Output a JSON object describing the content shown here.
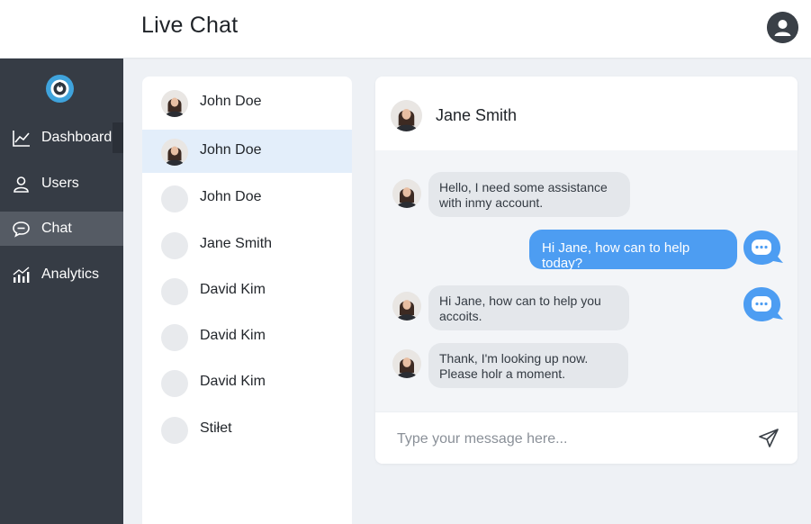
{
  "header": {
    "title": "Live Chat",
    "account_icon": "user-account-icon"
  },
  "sidebar": {
    "logo_icon": "app-logo",
    "items": [
      {
        "label": "Dashboard",
        "icon": "line-chart-icon",
        "active": false
      },
      {
        "label": "Users",
        "icon": "user-icon",
        "active": false
      },
      {
        "label": "Chat",
        "icon": "chat-bubble-icon",
        "active": true
      },
      {
        "label": "Analytics",
        "icon": "bar-chart-icon",
        "active": false
      }
    ]
  },
  "contacts": [
    {
      "name": "John Doe",
      "has_photo": true,
      "active": false
    },
    {
      "name": "John Doe",
      "has_photo": true,
      "active": true
    },
    {
      "name": "John Doe",
      "has_photo": false,
      "active": false
    },
    {
      "name": "Jane Smith",
      "has_photo": false,
      "active": false
    },
    {
      "name": "David Kim",
      "has_photo": false,
      "active": false
    },
    {
      "name": "David Kim",
      "has_photo": false,
      "active": false
    },
    {
      "name": "David Kim",
      "has_photo": false,
      "active": false
    },
    {
      "name": "Stiłet",
      "has_photo": false,
      "active": false
    }
  ],
  "chat": {
    "contact_name": "Jane Smith",
    "messages": [
      {
        "direction": "incoming",
        "text": "Hello, I need some assistance with inmy account."
      },
      {
        "direction": "outgoing",
        "text": "Hi Jane, how can to help today?"
      },
      {
        "direction": "incoming",
        "text": "Hi Jane, how can to help you accoits."
      },
      {
        "direction": "incoming",
        "text": "Thank, I'm looking up now. Please holr a moment."
      }
    ],
    "composer": {
      "placeholder": "Type your message here...",
      "value": ""
    }
  },
  "colors": {
    "sidebar_bg": "#363c45",
    "sidebar_active": "#555b64",
    "accent_blue": "#4d9df2",
    "contact_active_bg": "#e3eefa"
  }
}
